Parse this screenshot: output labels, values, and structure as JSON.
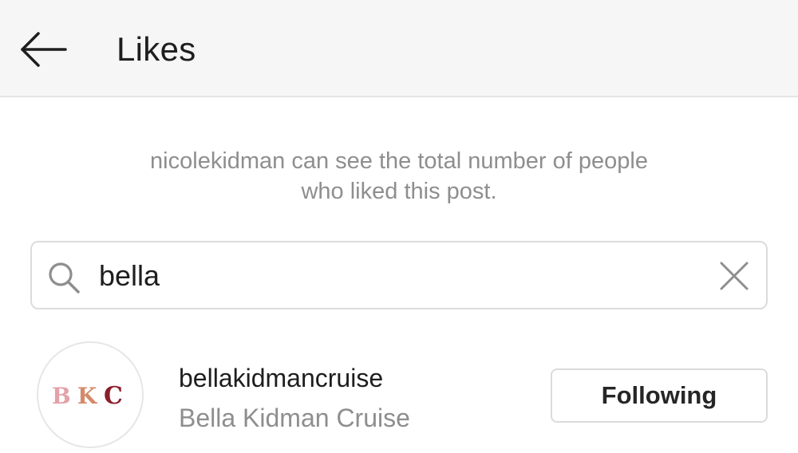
{
  "header": {
    "title": "Likes",
    "back_icon": "arrow-left-icon"
  },
  "notice": {
    "line1": "nicolekidman can see the total number of people",
    "line2": "who liked this post."
  },
  "search": {
    "value": "bella",
    "search_icon": "search-icon",
    "clear_icon": "close-icon"
  },
  "results": [
    {
      "username": "bellakidmancruise",
      "full_name": "Bella Kidman Cruise",
      "avatar_monogram": "BKC",
      "follow_label": "Following"
    }
  ],
  "colors": {
    "header_bg": "#f6f6f6",
    "secondary_text": "#8e8e8e",
    "primary_text": "#262626",
    "border": "#dbdbdb",
    "monogram_pink": "#e3a1a8",
    "monogram_dark": "#8b1e2b"
  }
}
